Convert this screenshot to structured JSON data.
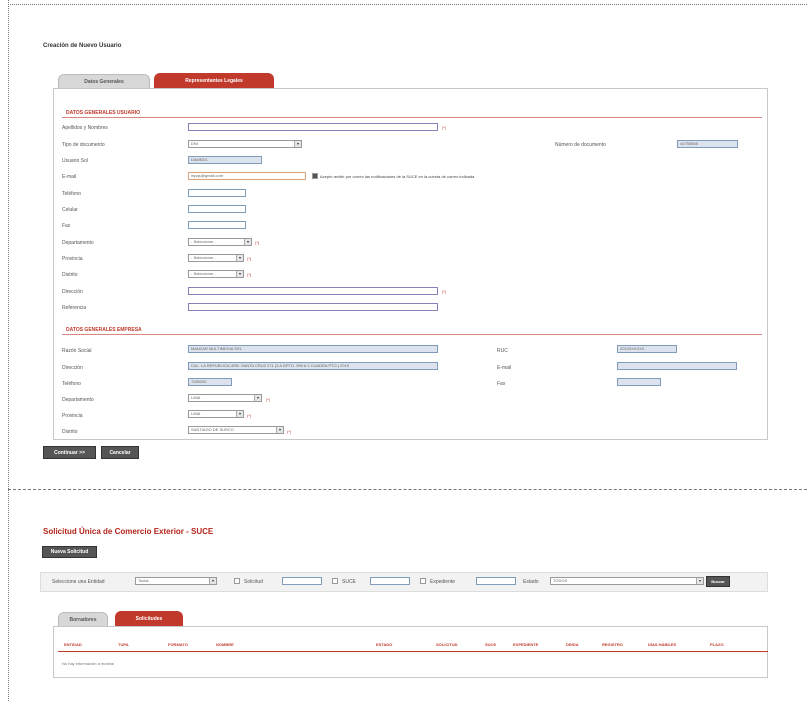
{
  "top": {
    "title": "Creación de Nuevo Usuario",
    "tabs": [
      {
        "label": "Datos Generales",
        "active": false
      },
      {
        "label": "Representantes Legales",
        "active": true
      }
    ],
    "section_user": "DATOS GENERALES USUARIO",
    "fields": {
      "apellidos_label": "Apellidos y Nombres",
      "tipo_doc_label": "Tipo de documento",
      "tipo_doc_value": "DNI",
      "num_doc_label": "Número de documento",
      "num_doc_value": "40755555",
      "ruc_label": "Usuario Sol",
      "ruc_value": "DAMED1",
      "email_label": "E-mail",
      "email_value": "mpqs@gmail.com",
      "email_consent": "Acepto recibir por correo las notificaciones de la SUCE en la cuenta de correo indicada",
      "telefono_label": "Teléfono",
      "celular_label": "Celular",
      "fax_label": "Fax",
      "departamento_label": "Departamento",
      "departamento_value": "- Seleccione -",
      "provincia_label": "Provincia",
      "provincia_value": "- Seleccione -",
      "distrito_label": "Distrito",
      "distrito_value": "- Seleccione -",
      "direccion_label": "Dirección",
      "referencia_label": "Referencia",
      "required_mark": "(*)"
    },
    "section_company": "DATOS GENERALES EMPRESA",
    "company": {
      "razon_label": "Razón Social",
      "razon_value": "MANZAR MULTIMEDIA SRL",
      "ruc_label": "RUC",
      "ruc_value": "20100XXXXX",
      "direccion_label": "Dirección",
      "direccion_value": "CAL. LA REPUBLICA URB. SANTA CRUZ 271 (3 A DPTO. 990 A 1 CUADRA PTO.) 2019",
      "email_label": "E-mail",
      "telefono_label": "Teléfono",
      "telefono_value": "7289290",
      "fax_label": "Fax",
      "departamento_label": "Departamento",
      "departamento_value": "LIMA",
      "provincia_label": "Provincia",
      "provincia_value": "LIMA",
      "distrito_label": "Distrito",
      "distrito_value": "SANTIAGO DE SURCO"
    },
    "buttons": {
      "continue": "Continuar >>",
      "cancel": "Cancelar"
    }
  },
  "bottom": {
    "title": "Solicitud Única de Comercio Exterior - SUCE",
    "new_button": "Nueva Solicitud",
    "filter": {
      "entity_label": "Seleccione una Entidad",
      "entity_value": "Todos",
      "solicitud_label": "Solicitud",
      "suce_label": "SUCE",
      "expediente_label": "Expediente",
      "estado_label": "Estado",
      "estado_value": "TODOS",
      "search_button": "Buscar"
    },
    "tabs": [
      {
        "label": "Borradores",
        "active": false
      },
      {
        "label": "Solicitudes",
        "active": true
      }
    ],
    "columns": [
      "ENTIDAD",
      "TUPA",
      "FORMATO",
      "NOMBRE",
      "ESTADO",
      "SOLICITUD",
      "SUCE",
      "EXPEDIENTE",
      "DR/DA",
      "REGISTRO",
      "DÍAS HÁBILES",
      "PLAZO"
    ],
    "empty_message": "No hay información a mostrar"
  }
}
